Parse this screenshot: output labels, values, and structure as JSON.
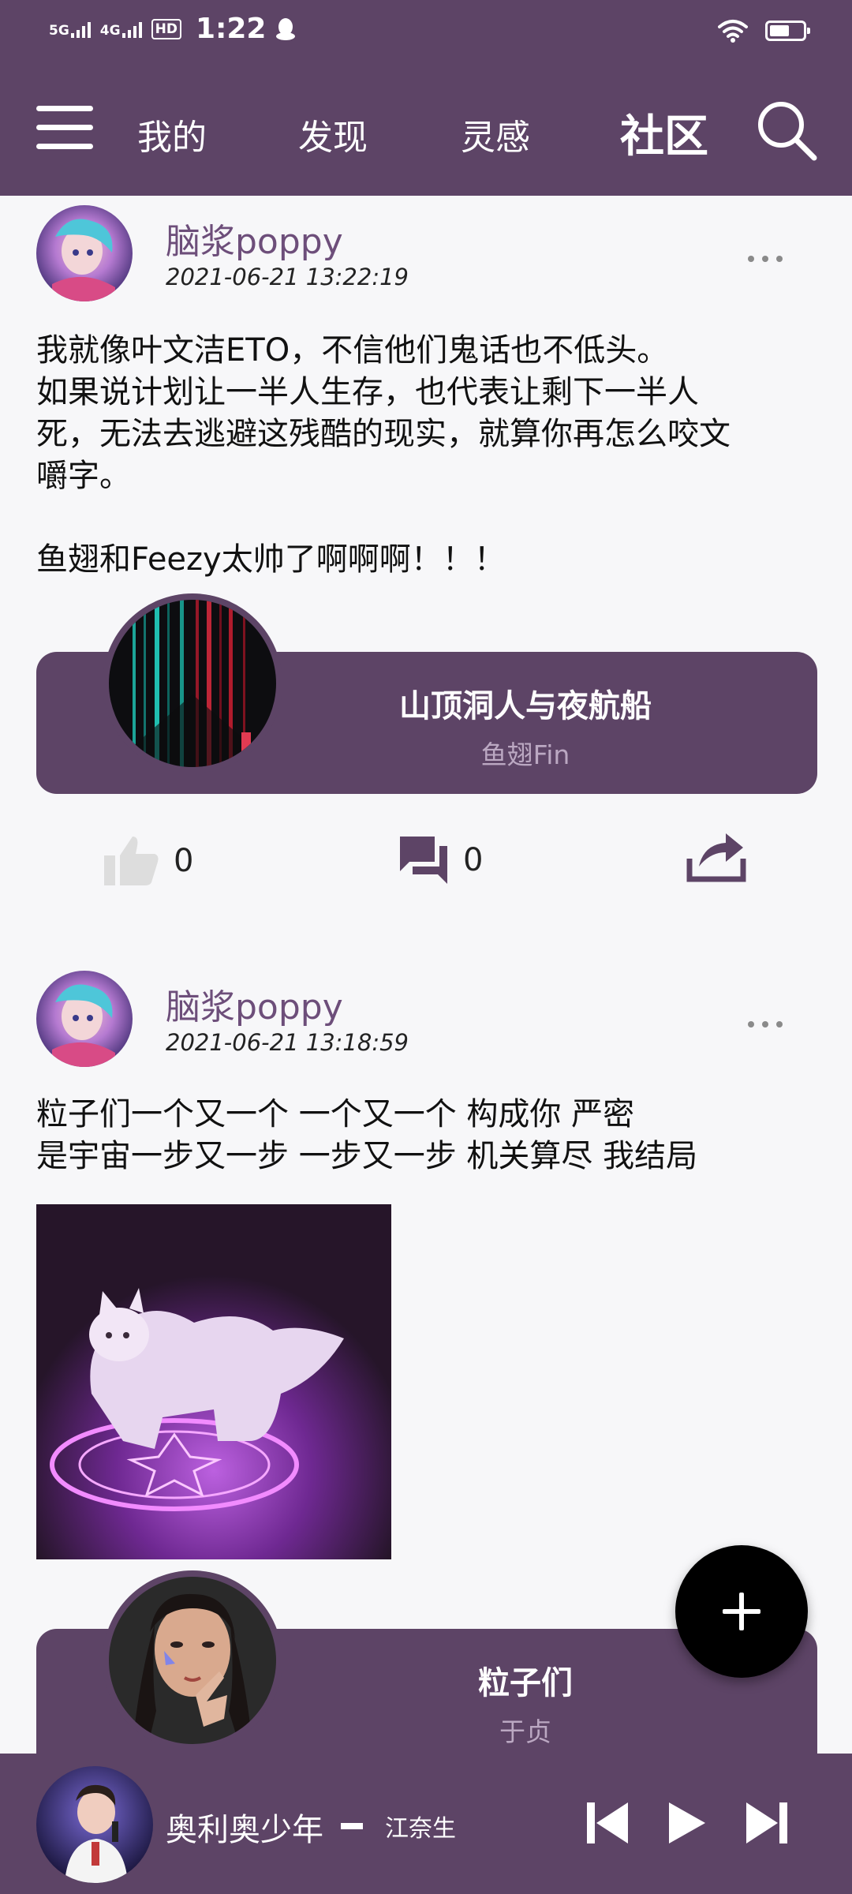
{
  "status_bar": {
    "signal_1": "5G",
    "signal_2": "4G",
    "hd_badge": "HD",
    "time": "1:22",
    "battery_percent": 60
  },
  "nav": {
    "tabs": [
      "我的",
      "发现",
      "灵感",
      "社区"
    ],
    "active_tab": "社区"
  },
  "posts": [
    {
      "username": "脑浆poppy",
      "time": "2021-06-21 13:22:19",
      "content_lines": [
        "我就像叶文洁ETO，不信他们鬼话也不低头。",
        "如果说计划让一半人生存，也代表让剩下一半人",
        "死，无法去逃避这残酷的现实，就算你再怎么咬文",
        "嚼字。",
        "",
        "鱼翅和Feezy太帅了啊啊啊！！！"
      ],
      "music": {
        "title": "山顶洞人与夜航船",
        "artist": "鱼翅Fin"
      },
      "likes": "0",
      "comments": "0"
    },
    {
      "username": "脑浆poppy",
      "time": "2021-06-21 13:18:59",
      "content_lines": [
        "粒子们一个又一个 一个又一个 构成你 严密",
        "是宇宙一步又一步 一步又一步 机关算尽 我结局"
      ],
      "music": {
        "title": "粒子们",
        "artist": "于贞"
      }
    }
  ],
  "player": {
    "title": "奥利奥少年",
    "artist": "江奈生"
  },
  "colors": {
    "brand": "#5d4466",
    "username": "#6d4e7a",
    "artist_muted": "#bba8c2"
  },
  "icons": [
    "menu-icon",
    "search-icon",
    "more-icon",
    "thumbs-up-icon",
    "comment-icon",
    "share-icon",
    "plus-icon",
    "skip-previous-icon",
    "play-icon",
    "skip-next-icon"
  ]
}
